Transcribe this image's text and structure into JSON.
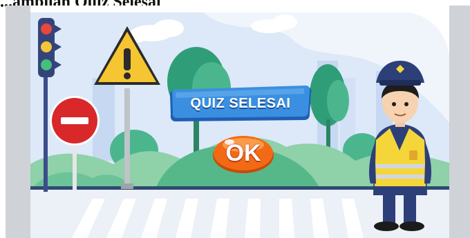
{
  "caption": "...ampilan Quiz Selesai",
  "quiz": {
    "title": "QUIZ SELESAI",
    "ok_label": "OK"
  },
  "colors": {
    "sky": "#dde8f8",
    "road": "#ecf0f7",
    "banner": "#3a8fe0",
    "ok_button": "#f26a15",
    "tree": "#2f9e78",
    "police_uniform": "#2d3f78",
    "vest": "#f4d63a"
  },
  "icons": [
    "traffic-light-icon",
    "warning-sign-icon",
    "no-entry-sign-icon",
    "police-officer-icon"
  ]
}
